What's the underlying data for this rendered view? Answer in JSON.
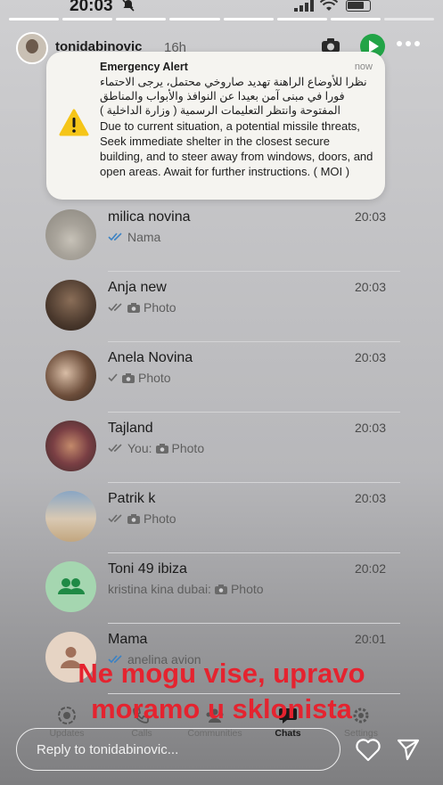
{
  "status": {
    "time": "20:03"
  },
  "story": {
    "username": "tonidabinovic",
    "age": "16h"
  },
  "alert": {
    "title": "Emergency Alert",
    "time": "now",
    "arabic": "نظرا للأوضاع الراهنة تهديد صاروخي محتمل، يرجى الاحتماء فورا في مبنى آمن بعيدا عن النوافذ والأبواب والمناطق المفتوحة وانتظر التعليمات الرسمية ( وزارة الداخلية )",
    "english": "Due to current situation, a potential missile threats, Seek immediate shelter in the closest secure building, and to steer away from windows, doors, and open areas. Await for further instructions. ( MOI  )"
  },
  "chats": [
    {
      "name": "milica novina",
      "time": "20:03",
      "prefix": "",
      "preview": "Nama",
      "ticks": "double-blue",
      "camera": false,
      "avatar": "photo"
    },
    {
      "name": "Anja new",
      "time": "20:03",
      "prefix": "",
      "preview": "Photo",
      "ticks": "double-grey",
      "camera": true,
      "avatar": "photo"
    },
    {
      "name": "Anela Novina",
      "time": "20:03",
      "prefix": "",
      "preview": "Photo",
      "ticks": "single-grey",
      "camera": true,
      "avatar": "photo"
    },
    {
      "name": "Tajland",
      "time": "20:03",
      "prefix": "You:",
      "preview": "Photo",
      "ticks": "double-grey",
      "camera": true,
      "avatar": "photo"
    },
    {
      "name": "Patrik k",
      "time": "20:03",
      "prefix": "",
      "preview": "Photo",
      "ticks": "double-grey",
      "camera": true,
      "avatar": "photo"
    },
    {
      "name": "Toni 49 ibiza",
      "time": "20:02",
      "prefix": "kristina kina dubai:",
      "preview": "Photo",
      "ticks": "none",
      "camera": true,
      "avatar": "group-icon"
    },
    {
      "name": "Mama",
      "time": "20:01",
      "prefix": "",
      "preview": "anelina avion",
      "ticks": "double-blue",
      "camera": false,
      "avatar": "person-icon"
    }
  ],
  "nav": {
    "updates": "Updates",
    "calls": "Calls",
    "communities": "Communities",
    "chats": "Chats",
    "settings": "Settings"
  },
  "caption": {
    "line1": "Ne mogu vise, upravo",
    "line2": "moramo u sklonista"
  },
  "reply": {
    "placeholder": "Reply to tonidabinovic..."
  },
  "colors": {
    "caption": "#e5232f",
    "whatsapp_green": "#22a447",
    "read_tick": "#3b82c4"
  }
}
